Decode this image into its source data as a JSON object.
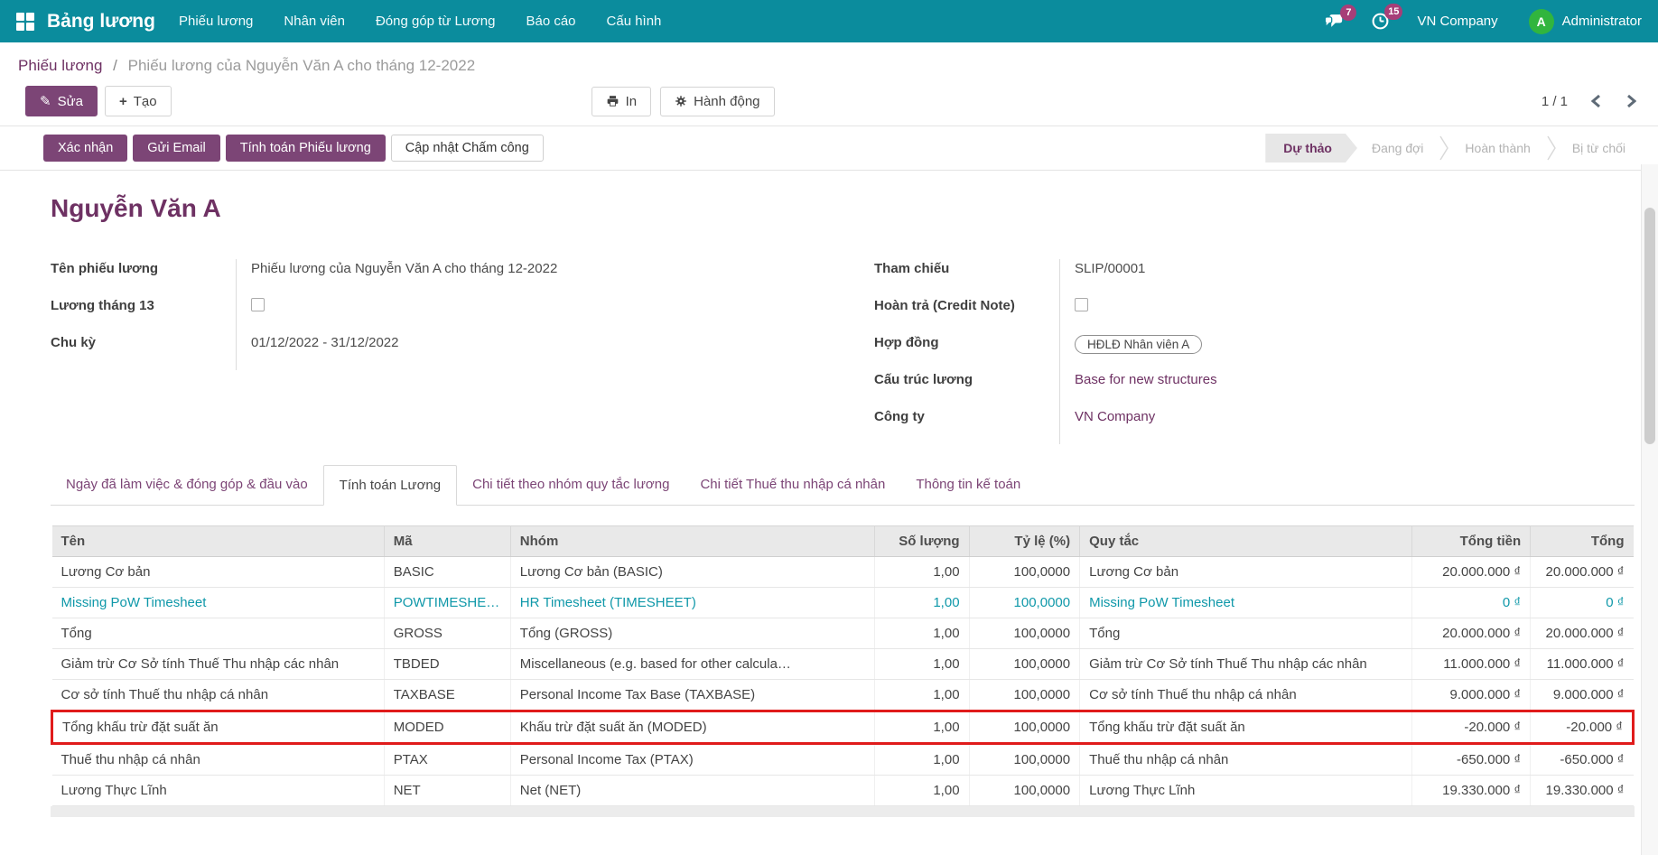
{
  "colors": {
    "navbar_teal": "#0B8C9D",
    "primary_purple": "#7C4576",
    "link_purple": "#6E3163",
    "table_teal_link": "#0F98A9",
    "highlight_red": "#E01B1B",
    "avatar_green": "#31B53E",
    "badge_pink": "#A73E78"
  },
  "navbar": {
    "brand": "Bảng lương",
    "menu": [
      "Phiếu lương",
      "Nhân viên",
      "Đóng góp từ Lương",
      "Báo cáo",
      "Cấu hình"
    ],
    "messages_badge": "7",
    "activities_badge": "15",
    "company": "VN Company",
    "user": "Administrator",
    "avatar_initial": "A"
  },
  "breadcrumb": {
    "parent": "Phiếu lương",
    "separator": "/",
    "current": "Phiếu lương của Nguyễn Văn A cho tháng 12-2022"
  },
  "control": {
    "edit": "Sửa",
    "create": "Tạo",
    "print": "In",
    "action": "Hành động",
    "pager": "1 / 1"
  },
  "statusbar": {
    "confirm": "Xác nhận",
    "send_email": "Gửi Email",
    "compute": "Tính toán Phiếu lương",
    "update_attendance": "Cập nhật Chấm công",
    "states": [
      "Dự thảo",
      "Đang đợi",
      "Hoàn thành",
      "Bị từ chối"
    ],
    "active_state": "Dự thảo"
  },
  "form": {
    "title": "Nguyễn Văn A",
    "slip_name_label": "Tên phiếu lương",
    "slip_name_value": "Phiếu lương của Nguyễn Văn A cho tháng 12-2022",
    "thirteen_month_label": "Lương tháng 13",
    "period_label": "Chu kỳ",
    "period_value": "01/12/2022 - 31/12/2022",
    "reference_label": "Tham chiếu",
    "reference_value": "SLIP/00001",
    "credit_note_label": "Hoàn trả (Credit Note)",
    "contract_label": "Hợp đồng",
    "contract_value": "HĐLĐ Nhân viên A",
    "structure_label": "Cấu trúc lương",
    "structure_value": "Base for new structures",
    "company_label": "Công ty",
    "company_value": "VN Company"
  },
  "tabs": [
    "Ngày đã làm việc & đóng góp & đầu vào",
    "Tính toán Lương",
    "Chi tiết theo nhóm quy tắc lương",
    "Chi tiết Thuế thu nhập cá nhân",
    "Thông tin kế toán"
  ],
  "table": {
    "headers": [
      "Tên",
      "Mã",
      "Nhóm",
      "Số lượng",
      "Tỷ lệ (%)",
      "Quy tắc",
      "Tổng tiền",
      "Tổng"
    ],
    "rows": [
      {
        "name": "Lương Cơ bản",
        "code": "BASIC",
        "group": "Lương Cơ bản (BASIC)",
        "quantity": "1,00",
        "rate": "100,0000",
        "rule": "Lương Cơ bản",
        "amount": "20.000.000 ₫",
        "total": "20.000.000 ₫"
      },
      {
        "name": "Missing PoW Timesheet",
        "code": "POWTIMESHE…",
        "group": "HR Timesheet (TIMESHEET)",
        "quantity": "1,00",
        "rate": "100,0000",
        "rule": "Missing PoW Timesheet",
        "amount": "0 ₫",
        "total": "0 ₫"
      },
      {
        "name": "Tổng",
        "code": "GROSS",
        "group": "Tổng (GROSS)",
        "quantity": "1,00",
        "rate": "100,0000",
        "rule": "Tổng",
        "amount": "20.000.000 ₫",
        "total": "20.000.000 ₫"
      },
      {
        "name": "Giảm trừ Cơ Sở tính Thuế Thu nhập các nhân",
        "code": "TBDED",
        "group": "Miscellaneous (e.g. based for other calcula…",
        "quantity": "1,00",
        "rate": "100,0000",
        "rule": "Giảm trừ Cơ Sở tính Thuế Thu nhập các nhân",
        "amount": "11.000.000 ₫",
        "total": "11.000.000 ₫"
      },
      {
        "name": "Cơ sở tính Thuế thu nhập cá nhân",
        "code": "TAXBASE",
        "group": "Personal Income Tax Base (TAXBASE)",
        "quantity": "1,00",
        "rate": "100,0000",
        "rule": "Cơ sở tính Thuế thu nhập cá nhân",
        "amount": "9.000.000 ₫",
        "total": "9.000.000 ₫"
      },
      {
        "name": "Tổng khấu trừ đặt suất ăn",
        "code": "MODED",
        "group": "Khấu trừ đặt suất ăn (MODED)",
        "quantity": "1,00",
        "rate": "100,0000",
        "rule": "Tổng khấu trừ đặt suất ăn",
        "amount": "-20.000 ₫",
        "total": "-20.000 ₫"
      },
      {
        "name": "Thuế thu nhập cá nhân",
        "code": "PTAX",
        "group": "Personal Income Tax (PTAX)",
        "quantity": "1,00",
        "rate": "100,0000",
        "rule": "Thuế thu nhập cá nhân",
        "amount": "-650.000 ₫",
        "total": "-650.000 ₫"
      },
      {
        "name": "Lương Thực Lĩnh",
        "code": "NET",
        "group": "Net (NET)",
        "quantity": "1,00",
        "rate": "100,0000",
        "rule": "Lương Thực Lĩnh",
        "amount": "19.330.000 ₫",
        "total": "19.330.000 ₫"
      }
    ]
  }
}
